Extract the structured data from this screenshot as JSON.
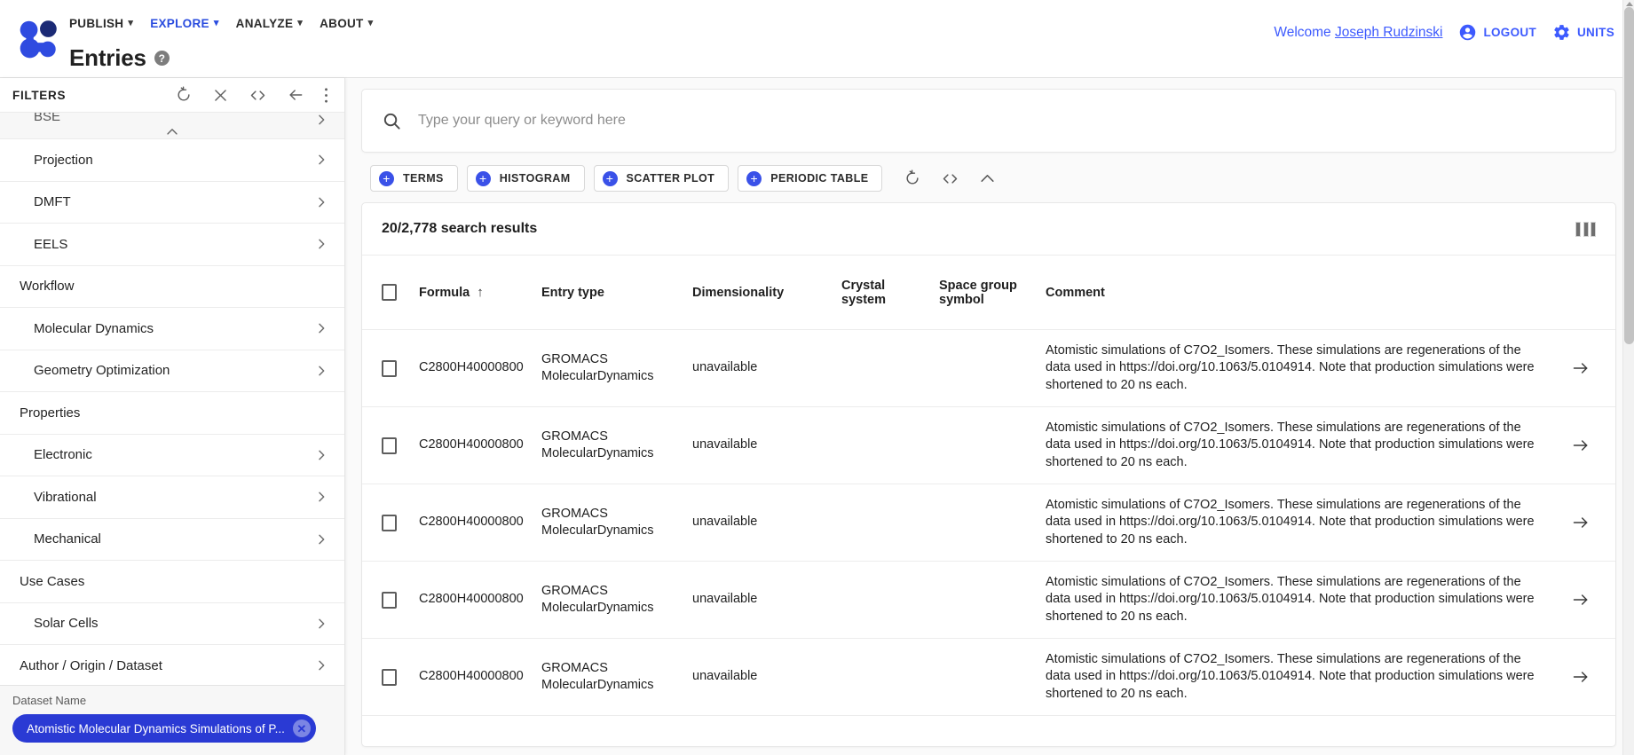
{
  "header": {
    "logo_name": "nomad-logo",
    "menu": [
      {
        "label": "PUBLISH",
        "active": false
      },
      {
        "label": "EXPLORE",
        "active": true
      },
      {
        "label": "ANALYZE",
        "active": false
      },
      {
        "label": "ABOUT",
        "active": false
      }
    ],
    "page_title": "Entries",
    "help_glyph": "?",
    "welcome_prefix": "Welcome ",
    "user_name": "Joseph Rudzinski",
    "logout_label": "LOGOUT",
    "units_label": "UNITS",
    "accent_color": "#3d5afe"
  },
  "sidebar": {
    "title": "FILTERS",
    "actions": [
      {
        "name": "reset-filters-icon",
        "label": "reset"
      },
      {
        "name": "close-filters-icon",
        "label": "close"
      },
      {
        "name": "code-filters-icon",
        "label": "code"
      },
      {
        "name": "back-filters-icon",
        "label": "back"
      },
      {
        "name": "more-filters-icon",
        "label": "more"
      }
    ],
    "items": [
      {
        "label": "BSE",
        "type": "item",
        "cut": true,
        "collapse": true
      },
      {
        "label": "Projection",
        "type": "item"
      },
      {
        "label": "DMFT",
        "type": "item"
      },
      {
        "label": "EELS",
        "type": "item"
      },
      {
        "label": "Workflow",
        "type": "group"
      },
      {
        "label": "Molecular Dynamics",
        "type": "item"
      },
      {
        "label": "Geometry Optimization",
        "type": "item"
      },
      {
        "label": "Properties",
        "type": "group"
      },
      {
        "label": "Electronic",
        "type": "item"
      },
      {
        "label": "Vibrational",
        "type": "item"
      },
      {
        "label": "Mechanical",
        "type": "item"
      },
      {
        "label": "Use Cases",
        "type": "group"
      },
      {
        "label": "Solar Cells",
        "type": "item"
      },
      {
        "label": "Author / Origin / Dataset",
        "type": "group-link"
      }
    ],
    "dataset_label": "Dataset Name",
    "dataset_chip": "Atomistic Molecular Dynamics Simulations of P...",
    "chip_close_glyph": "✕",
    "chip_color": "#2a3ad4"
  },
  "search": {
    "placeholder": "Type your query or keyword here",
    "value": "",
    "icon": "search-icon"
  },
  "viz_buttons": [
    {
      "label": "TERMS"
    },
    {
      "label": "HISTOGRAM"
    },
    {
      "label": "SCATTER PLOT"
    },
    {
      "label": "PERIODIC TABLE"
    }
  ],
  "viz_icons": [
    {
      "name": "reset-viz-icon"
    },
    {
      "name": "code-viz-icon"
    },
    {
      "name": "collapse-viz-icon"
    }
  ],
  "results": {
    "count_text": "20/2,778 search results",
    "columns_icon": "columns-icon",
    "columns": [
      {
        "key": "check",
        "label": ""
      },
      {
        "key": "formula",
        "label": "Formula",
        "sorted": "asc",
        "sort_glyph": "↑"
      },
      {
        "key": "entry",
        "label": "Entry type"
      },
      {
        "key": "dim",
        "label": "Dimensionality"
      },
      {
        "key": "crystal",
        "label": "Crystal system"
      },
      {
        "key": "space",
        "label": "Space group symbol"
      },
      {
        "key": "comment",
        "label": "Comment"
      },
      {
        "key": "arrow",
        "label": ""
      }
    ],
    "rows": [
      {
        "formula": "C2800H40000800",
        "entry_type": "GROMACS MolecularDynamics",
        "dimensionality": "unavailable",
        "crystal_system": "",
        "space_group_symbol": "",
        "comment": "Atomistic simulations of C7O2_Isomers. These simulations are regenerations of the data used in https://doi.org/10.1063/5.0104914. Note that production simulations were shortened to 20 ns each."
      },
      {
        "formula": "C2800H40000800",
        "entry_type": "GROMACS MolecularDynamics",
        "dimensionality": "unavailable",
        "crystal_system": "",
        "space_group_symbol": "",
        "comment": "Atomistic simulations of C7O2_Isomers. These simulations are regenerations of the data used in https://doi.org/10.1063/5.0104914. Note that production simulations were shortened to 20 ns each."
      },
      {
        "formula": "C2800H40000800",
        "entry_type": "GROMACS MolecularDynamics",
        "dimensionality": "unavailable",
        "crystal_system": "",
        "space_group_symbol": "",
        "comment": "Atomistic simulations of C7O2_Isomers. These simulations are regenerations of the data used in https://doi.org/10.1063/5.0104914. Note that production simulations were shortened to 20 ns each."
      },
      {
        "formula": "C2800H40000800",
        "entry_type": "GROMACS MolecularDynamics",
        "dimensionality": "unavailable",
        "crystal_system": "",
        "space_group_symbol": "",
        "comment": "Atomistic simulations of C7O2_Isomers. These simulations are regenerations of the data used in https://doi.org/10.1063/5.0104914. Note that production simulations were shortened to 20 ns each."
      },
      {
        "formula": "C2800H40000800",
        "entry_type": "GROMACS MolecularDynamics",
        "dimensionality": "unavailable",
        "crystal_system": "",
        "space_group_symbol": "",
        "comment": "Atomistic simulations of C7O2_Isomers. These simulations are regenerations of the data used in https://doi.org/10.1063/5.0104914. Note that production simulations were shortened to 20 ns each."
      }
    ]
  }
}
